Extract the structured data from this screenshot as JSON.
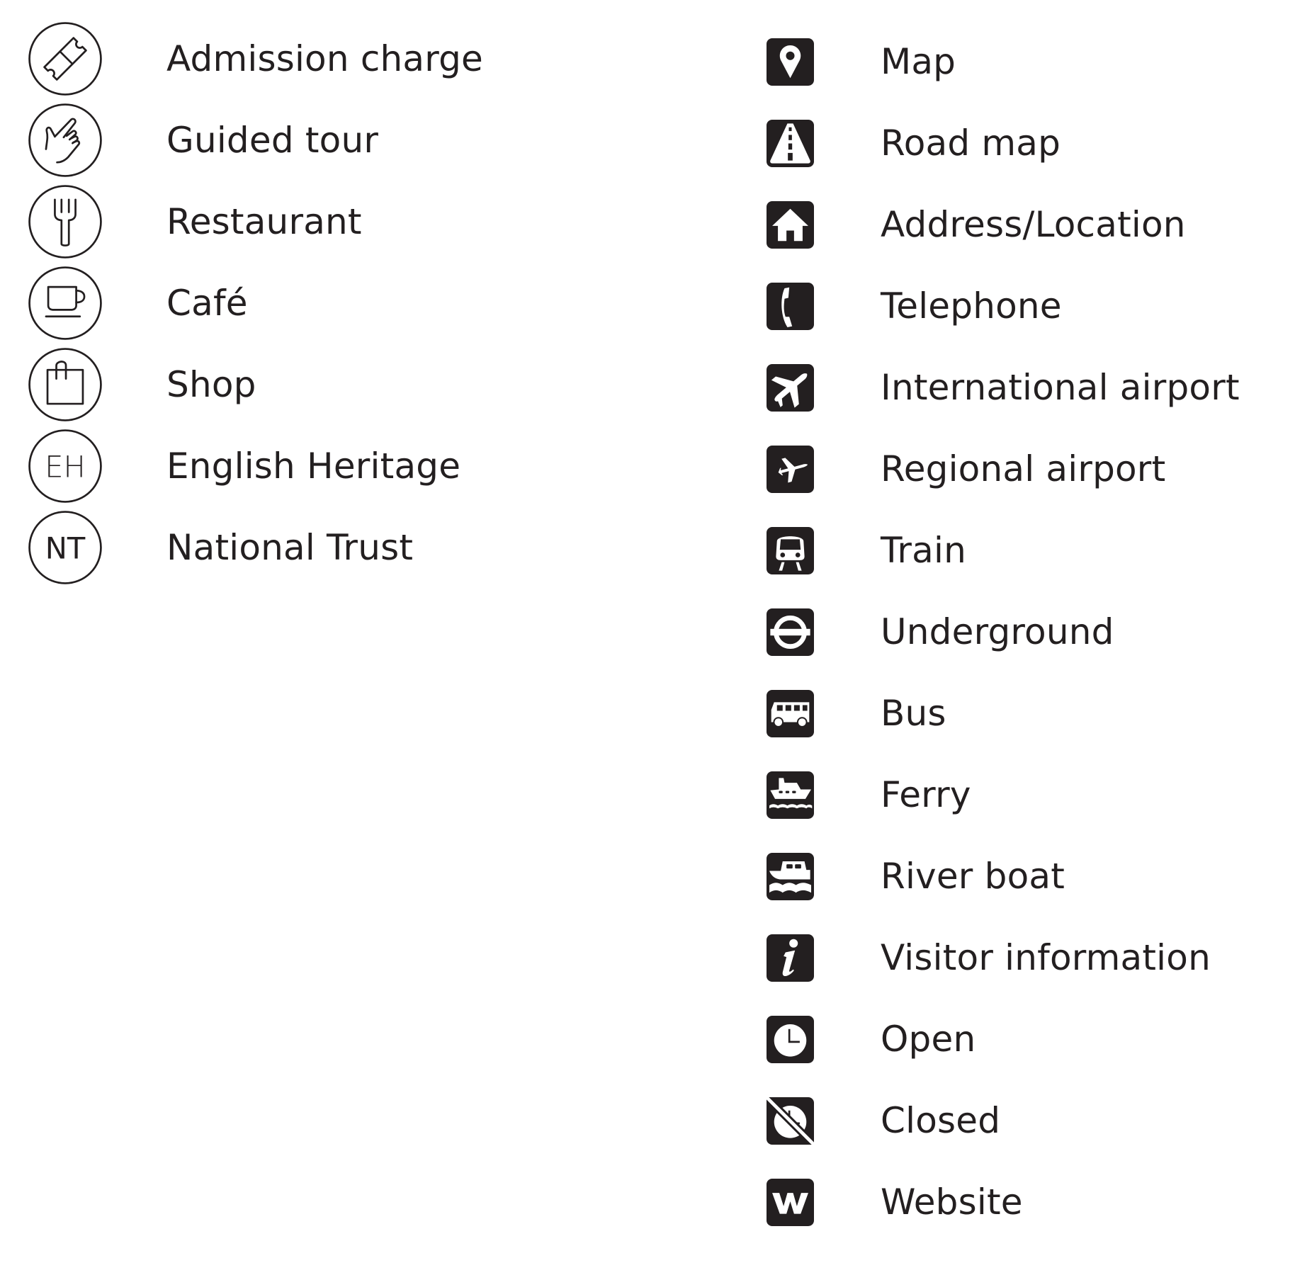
{
  "legend": {
    "left": [
      {
        "label": "Admission charge",
        "icon": "ticket-icon"
      },
      {
        "label": "Guided tour",
        "icon": "pointing-hand-icon"
      },
      {
        "label": "Restaurant",
        "icon": "fork-icon"
      },
      {
        "label": "Café",
        "icon": "coffee-cup-icon"
      },
      {
        "label": "Shop",
        "icon": "shopping-bag-icon"
      },
      {
        "label": "English Heritage",
        "icon": "english-heritage-icon",
        "icon_text": "EH"
      },
      {
        "label": "National Trust",
        "icon": "national-trust-icon",
        "icon_text": "NT"
      }
    ],
    "right": [
      {
        "label": "Map",
        "icon": "map-pin-icon"
      },
      {
        "label": "Road map",
        "icon": "road-icon"
      },
      {
        "label": "Address/Location",
        "icon": "house-icon"
      },
      {
        "label": "Telephone",
        "icon": "telephone-icon"
      },
      {
        "label": "International airport",
        "icon": "large-airplane-icon"
      },
      {
        "label": "Regional airport",
        "icon": "small-airplane-icon"
      },
      {
        "label": "Train",
        "icon": "train-icon"
      },
      {
        "label": "Underground",
        "icon": "underground-roundel-icon"
      },
      {
        "label": "Bus",
        "icon": "bus-icon"
      },
      {
        "label": "Ferry",
        "icon": "ferry-icon"
      },
      {
        "label": "River boat",
        "icon": "river-boat-icon"
      },
      {
        "label": "Visitor information",
        "icon": "information-icon"
      },
      {
        "label": "Open",
        "icon": "clock-icon"
      },
      {
        "label": "Closed",
        "icon": "clock-crossed-icon"
      },
      {
        "label": "Website",
        "icon": "website-w-icon"
      }
    ]
  },
  "colors": {
    "ink": "#231f20",
    "background": "#ffffff"
  }
}
